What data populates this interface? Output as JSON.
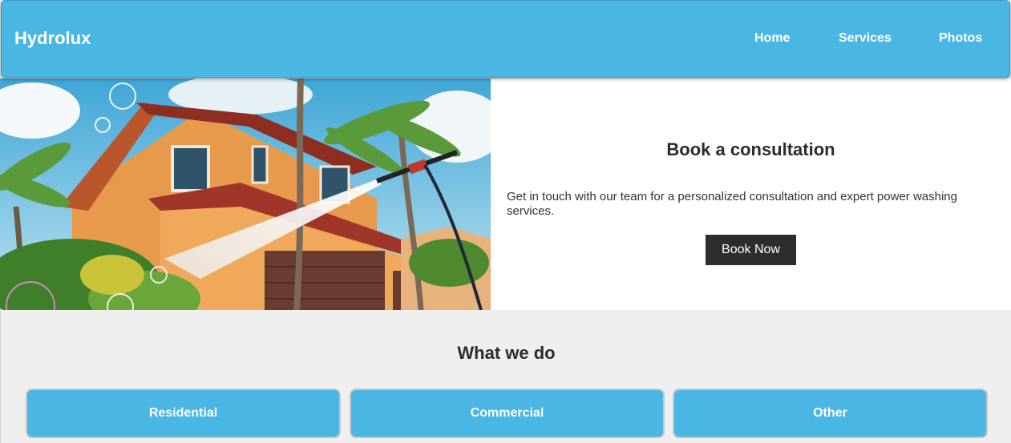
{
  "header": {
    "brand": "Hydrolux",
    "nav": [
      {
        "label": "Home"
      },
      {
        "label": "Services"
      },
      {
        "label": "Photos"
      }
    ],
    "accent_color": "#4ab6e4"
  },
  "hero": {
    "image_icon": "house-power-washing-illustration",
    "title": "Book a consultation",
    "description": "Get in touch with our team for a personalized consultation and expert power washing services.",
    "button_label": "Book Now"
  },
  "what_we_do": {
    "title": "What we do",
    "cards": [
      {
        "label": "Residential"
      },
      {
        "label": "Commercial"
      },
      {
        "label": "Other"
      }
    ]
  }
}
